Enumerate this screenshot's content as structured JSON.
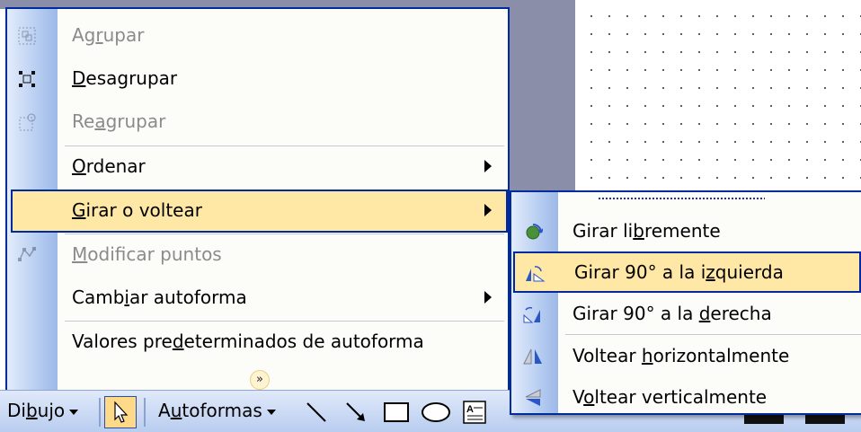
{
  "menu": {
    "items": [
      {
        "pre": "Ag",
        "acc": "r",
        "post": "upar",
        "disabled": true,
        "icon": "group-icon"
      },
      {
        "pre": "",
        "acc": "D",
        "post": "esagrupar",
        "disabled": false,
        "icon": "ungroup-icon"
      },
      {
        "pre": "Re",
        "acc": "a",
        "post": "grupar",
        "disabled": true,
        "icon": "regroup-icon"
      },
      {
        "pre": "",
        "acc": "O",
        "post": "rdenar",
        "disabled": false,
        "submenu": true
      },
      {
        "pre": "",
        "acc": "G",
        "post": "irar o voltear",
        "disabled": false,
        "submenu": true,
        "highlighted": true
      },
      {
        "pre": "",
        "acc": "M",
        "post": "odificar puntos",
        "disabled": true,
        "icon": "edit-points-icon"
      },
      {
        "pre": "Camb",
        "acc": "i",
        "post": "ar autoforma",
        "disabled": false,
        "submenu": true
      },
      {
        "pre": "Valores pre",
        "acc": "d",
        "post": "eterminados de autoforma",
        "disabled": false
      }
    ],
    "expand_icon": "chevron-double-down-icon"
  },
  "submenu": {
    "items": [
      {
        "pre": "Girar li",
        "acc": "b",
        "post": "remente",
        "icon": "free-rotate-icon"
      },
      {
        "pre": "Girar 90° a la i",
        "acc": "z",
        "post": "quierda",
        "icon": "rotate-left-icon",
        "highlighted": true
      },
      {
        "pre": "Girar 90° a la ",
        "acc": "d",
        "post": "erecha",
        "icon": "rotate-right-icon"
      },
      {
        "pre": "Voltear ",
        "acc": "h",
        "post": "orizontalmente",
        "icon": "flip-horizontal-icon"
      },
      {
        "pre": "V",
        "acc": "o",
        "post": "ltear verticalmente",
        "icon": "flip-vertical-icon"
      }
    ]
  },
  "toolbar": {
    "dibujo": {
      "pre": "Di",
      "acc": "b",
      "post": "ujo"
    },
    "autoformas": {
      "pre": "A",
      "acc": "u",
      "post": "toformas"
    }
  },
  "colors": {
    "highlight": "#ffe8a6",
    "border": "#002b9e",
    "disabled_text": "#8b8b8b"
  }
}
